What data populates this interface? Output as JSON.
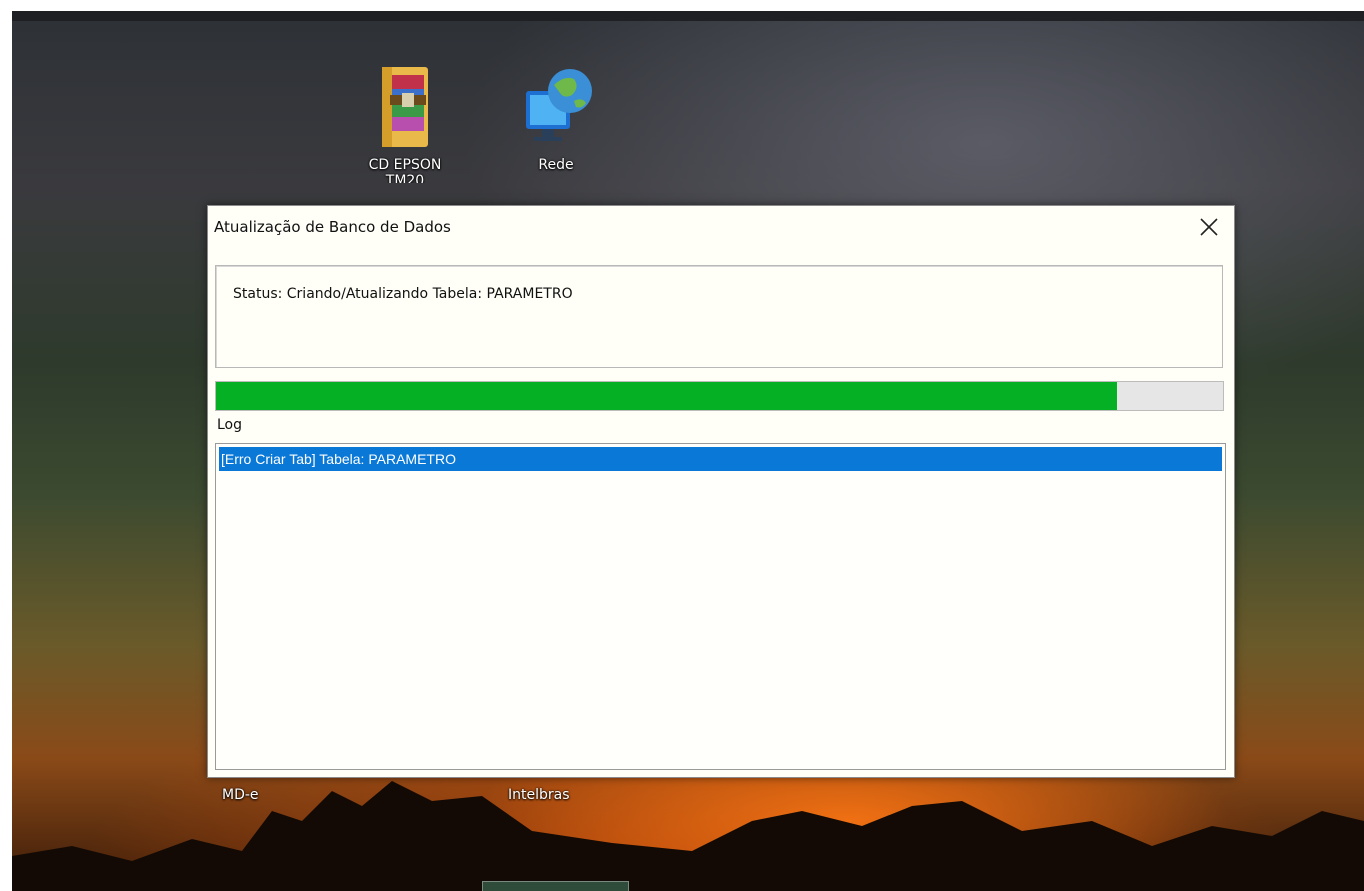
{
  "desktop": {
    "icons": [
      {
        "label": "CD EPSON",
        "label_line2": "TM20",
        "icon": "winrar-folder-icon"
      },
      {
        "label": "Rede",
        "icon": "network-globe-icon"
      }
    ],
    "bottom_labels": [
      "MD-e",
      "Intelbras"
    ]
  },
  "dialog": {
    "title": "Atualização de Banco de Dados",
    "close_icon": "close-icon",
    "status_text": "Status:  Criando/Atualizando Tabela: PARAMETRO",
    "progress": 0.895,
    "progress_color": "#06b025",
    "log_label": "Log",
    "log_entries": [
      "[Erro Criar Tab] Tabela: PARAMETRO"
    ],
    "selection_color": "#0a78d7"
  }
}
